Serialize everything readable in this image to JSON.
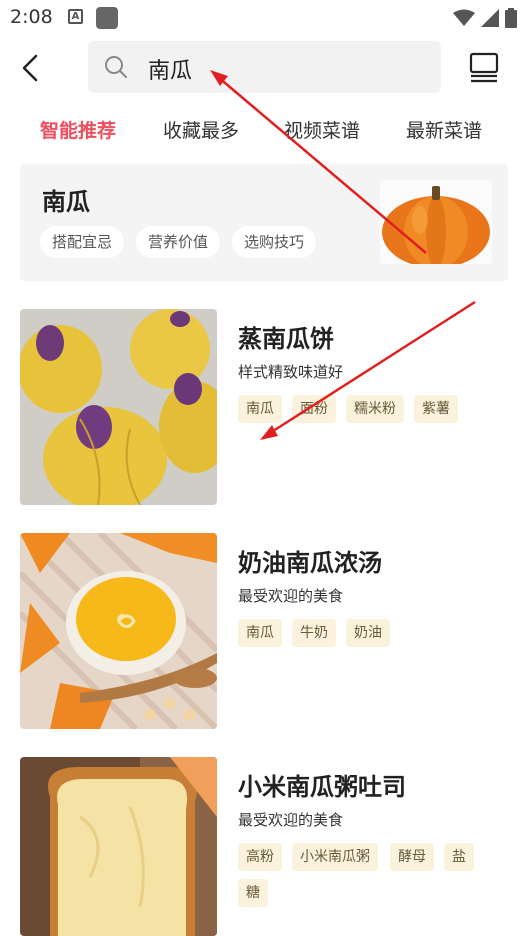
{
  "status_bar": {
    "time": "2:08",
    "a_icon_letter": "A"
  },
  "header": {
    "search_value": "南瓜"
  },
  "tabs": [
    "智能推荐",
    "收藏最多",
    "视频菜谱",
    "最新菜谱"
  ],
  "feature": {
    "title": "南瓜",
    "chips": [
      "搭配宜忌",
      "营养价值",
      "选购技巧"
    ]
  },
  "recipes": [
    {
      "title": "蒸南瓜饼",
      "desc": "样式精致味道好",
      "tags": [
        "南瓜",
        "面粉",
        "糯米粉",
        "紫薯"
      ]
    },
    {
      "title": "奶油南瓜浓汤",
      "desc": "最受欢迎的美食",
      "tags": [
        "南瓜",
        "牛奶",
        "奶油"
      ]
    },
    {
      "title": "小米南瓜粥吐司",
      "desc": "最受欢迎的美食",
      "tags": [
        "高粉",
        "小米南瓜粥",
        "酵母",
        "盐",
        "糖"
      ]
    }
  ],
  "colors": {
    "accent": "#ee4f5e",
    "tag_bg": "#faf2dc",
    "annotation": "#e02020"
  }
}
